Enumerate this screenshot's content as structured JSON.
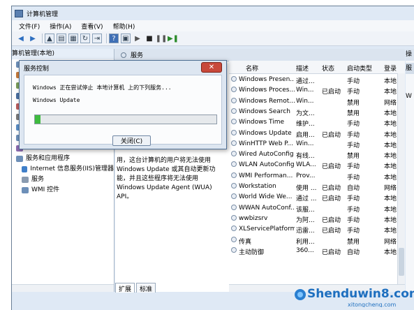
{
  "window": {
    "title": "计算机管理"
  },
  "menu": [
    "文件(F)",
    "操作(A)",
    "查看(V)",
    "帮助(H)"
  ],
  "tree": {
    "root": "算机管理(本地)",
    "items": [
      {
        "label": "系",
        "color": "#6d8fb8"
      },
      {
        "label": "",
        "color": "#c47a3b"
      },
      {
        "label": "",
        "color": "#7a9c5a"
      },
      {
        "label": "",
        "color": "#4a6fa0"
      },
      {
        "label": "",
        "color": "#b85c5c"
      },
      {
        "label": "",
        "color": "#7a7a7a"
      },
      {
        "label": "",
        "color": "#5b8ec5"
      },
      {
        "label": "存",
        "color": "#6d8fb8"
      },
      {
        "label": "",
        "color": "#8b6bb0"
      },
      {
        "label": "服务和应用程序",
        "color": "#6d8fb8"
      },
      {
        "label": "Internet 信息服务(IIS)管理器",
        "color": "#3f7fc9"
      },
      {
        "label": "服务",
        "color": "#8a9bb0"
      },
      {
        "label": "WMI 控件",
        "color": "#6d8fb8"
      }
    ]
  },
  "services_pane": {
    "title": "服务"
  },
  "description": [
    "用，这台计算机的用户将无法使用",
    "Windows Update 或其自动更新功",
    "能，并且这些程序将无法使用",
    "Windows Update Agent (WUA)",
    "API。"
  ],
  "columns": [
    "名称",
    "描述",
    "状态",
    "启动类型",
    "登录"
  ],
  "services": [
    {
      "name": "Windows Presen...",
      "desc": "通过...",
      "status": "",
      "start": "手动",
      "logon": "本地"
    },
    {
      "name": "Windows Proces...",
      "desc": "Win...",
      "status": "已启动",
      "start": "手动",
      "logon": "本地"
    },
    {
      "name": "Windows Remot...",
      "desc": "Win...",
      "status": "",
      "start": "禁用",
      "logon": "网络"
    },
    {
      "name": "Windows Search",
      "desc": "为文...",
      "status": "",
      "start": "禁用",
      "logon": "本地"
    },
    {
      "name": "Windows Time",
      "desc": "维护...",
      "status": "",
      "start": "手动",
      "logon": "本地"
    },
    {
      "name": "Windows Update",
      "desc": "启用...",
      "status": "已启动",
      "start": "手动",
      "logon": "本地"
    },
    {
      "name": "WinHTTP Web P...",
      "desc": "Win...",
      "status": "",
      "start": "手动",
      "logon": "本地"
    },
    {
      "name": "Wired AutoConfig",
      "desc": "有线...",
      "status": "",
      "start": "禁用",
      "logon": "本地"
    },
    {
      "name": "WLAN AutoConfig",
      "desc": "WLA...",
      "status": "已启动",
      "start": "手动",
      "logon": "本地"
    },
    {
      "name": "WMI Performan...",
      "desc": "Prov...",
      "status": "",
      "start": "手动",
      "logon": "本地"
    },
    {
      "name": "Workstation",
      "desc": "使用 ...",
      "status": "已启动",
      "start": "自动",
      "logon": "网络"
    },
    {
      "name": "World Wide We...",
      "desc": "通过 ...",
      "status": "已启动",
      "start": "手动",
      "logon": "本地"
    },
    {
      "name": "WWAN AutoConf...",
      "desc": "该服...",
      "status": "",
      "start": "手动",
      "logon": "本地"
    },
    {
      "name": "wwbizsrv",
      "desc": "为阿...",
      "status": "已启动",
      "start": "手动",
      "logon": "本地"
    },
    {
      "name": "XLServicePlatform",
      "desc": "迅雷...",
      "status": "已启动",
      "start": "手动",
      "logon": "本地"
    },
    {
      "name": "传真",
      "desc": "利用...",
      "status": "",
      "start": "禁用",
      "logon": "网络"
    },
    {
      "name": "主动防御",
      "desc": "360...",
      "status": "已启动",
      "start": "自动",
      "logon": "本地"
    }
  ],
  "actions": [
    "操",
    "服",
    "W"
  ],
  "tabs": [
    "扩展",
    "标准"
  ],
  "dialog": {
    "title": "服务控制",
    "line1": "Windows 正在尝试停止 本地计算机 上的下列服务...",
    "line2": "Windows Update",
    "progress": 0.03,
    "close_label": "关闭(C)"
  },
  "watermark": {
    "text": "Shenduwin8.com",
    "sub": "xitongcheng.com"
  }
}
